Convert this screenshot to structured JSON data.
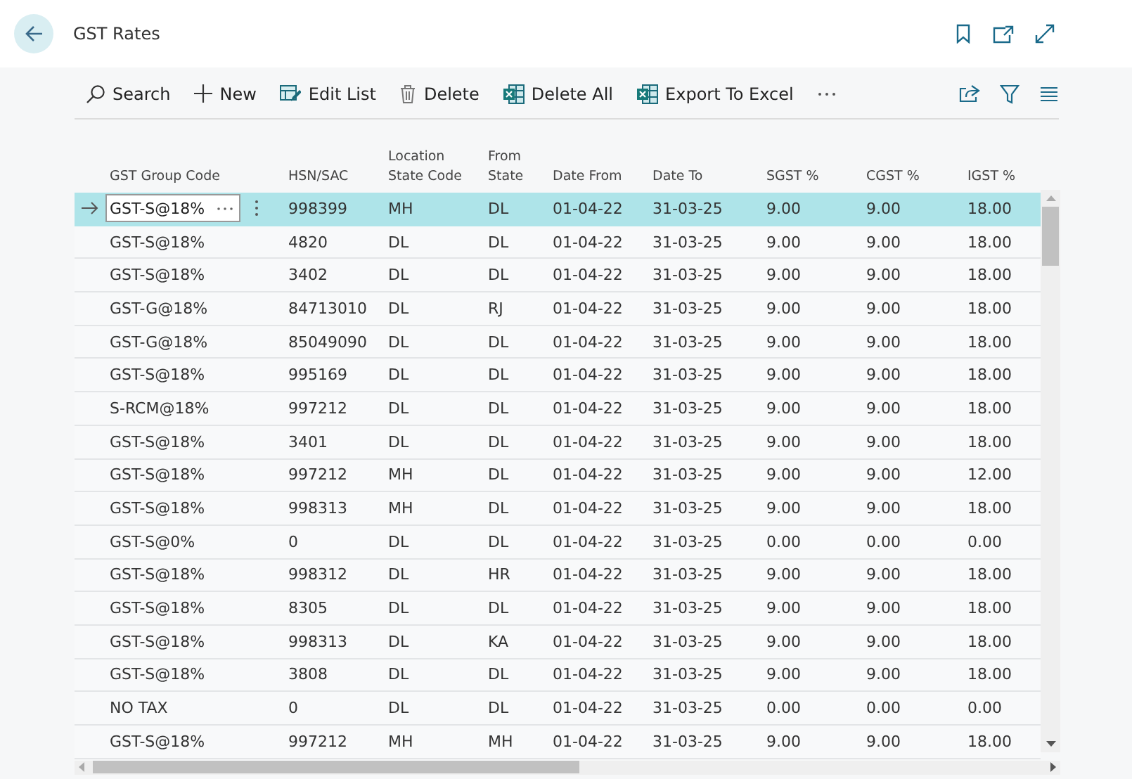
{
  "window": {
    "title": "GST Rates"
  },
  "actions": [
    {
      "kind": "search",
      "label": "Search"
    },
    {
      "kind": "new",
      "label": "New"
    },
    {
      "kind": "edit",
      "label": "Edit List"
    },
    {
      "kind": "delete",
      "label": "Delete"
    },
    {
      "kind": "excel",
      "label": "Delete All"
    },
    {
      "kind": "excel",
      "label": "Export To Excel"
    }
  ],
  "table": {
    "columns": [
      "GST Group Code",
      "HSN/SAC",
      "Location State Code",
      "From State",
      "Date From",
      "Date To",
      "SGST %",
      "CGST %",
      "IGST %"
    ],
    "rows": [
      {
        "selected": true,
        "cells": [
          "GST-S@18%",
          "998399",
          "MH",
          "DL",
          "01-04-22",
          "31-03-25",
          "9.00",
          "9.00",
          "18.00"
        ]
      },
      {
        "selected": false,
        "cells": [
          "GST-S@18%",
          "4820",
          "DL",
          "DL",
          "01-04-22",
          "31-03-25",
          "9.00",
          "9.00",
          "18.00"
        ]
      },
      {
        "selected": false,
        "cells": [
          "GST-S@18%",
          "3402",
          "DL",
          "DL",
          "01-04-22",
          "31-03-25",
          "9.00",
          "9.00",
          "18.00"
        ]
      },
      {
        "selected": false,
        "cells": [
          "GST-G@18%",
          "84713010",
          "DL",
          "RJ",
          "01-04-22",
          "31-03-25",
          "9.00",
          "9.00",
          "18.00"
        ]
      },
      {
        "selected": false,
        "cells": [
          "GST-G@18%",
          "85049090",
          "DL",
          "DL",
          "01-04-22",
          "31-03-25",
          "9.00",
          "9.00",
          "18.00"
        ]
      },
      {
        "selected": false,
        "cells": [
          "GST-S@18%",
          "995169",
          "DL",
          "DL",
          "01-04-22",
          "31-03-25",
          "9.00",
          "9.00",
          "18.00"
        ]
      },
      {
        "selected": false,
        "cells": [
          "S-RCM@18%",
          "997212",
          "DL",
          "DL",
          "01-04-22",
          "31-03-25",
          "9.00",
          "9.00",
          "18.00"
        ]
      },
      {
        "selected": false,
        "cells": [
          "GST-S@18%",
          "3401",
          "DL",
          "DL",
          "01-04-22",
          "31-03-25",
          "9.00",
          "9.00",
          "18.00"
        ]
      },
      {
        "selected": false,
        "cells": [
          "GST-S@18%",
          "997212",
          "MH",
          "DL",
          "01-04-22",
          "31-03-25",
          "9.00",
          "9.00",
          "12.00"
        ]
      },
      {
        "selected": false,
        "cells": [
          "GST-S@18%",
          "998313",
          "MH",
          "DL",
          "01-04-22",
          "31-03-25",
          "9.00",
          "9.00",
          "18.00"
        ]
      },
      {
        "selected": false,
        "cells": [
          "GST-S@0%",
          "0",
          "DL",
          "DL",
          "01-04-22",
          "31-03-25",
          "0.00",
          "0.00",
          "0.00"
        ]
      },
      {
        "selected": false,
        "cells": [
          "GST-S@18%",
          "998312",
          "DL",
          "HR",
          "01-04-22",
          "31-03-25",
          "9.00",
          "9.00",
          "18.00"
        ]
      },
      {
        "selected": false,
        "cells": [
          "GST-S@18%",
          "8305",
          "DL",
          "DL",
          "01-04-22",
          "31-03-25",
          "9.00",
          "9.00",
          "18.00"
        ]
      },
      {
        "selected": false,
        "cells": [
          "GST-S@18%",
          "998313",
          "DL",
          "KA",
          "01-04-22",
          "31-03-25",
          "9.00",
          "9.00",
          "18.00"
        ]
      },
      {
        "selected": false,
        "cells": [
          "GST-S@18%",
          "3808",
          "DL",
          "DL",
          "01-04-22",
          "31-03-25",
          "9.00",
          "9.00",
          "18.00"
        ]
      },
      {
        "selected": false,
        "cells": [
          "NO TAX",
          "0",
          "DL",
          "DL",
          "01-04-22",
          "31-03-25",
          "0.00",
          "0.00",
          "0.00"
        ]
      },
      {
        "selected": false,
        "cells": [
          "GST-S@18%",
          "997212",
          "MH",
          "MH",
          "01-04-22",
          "31-03-25",
          "9.00",
          "9.00",
          "18.00"
        ]
      }
    ]
  }
}
